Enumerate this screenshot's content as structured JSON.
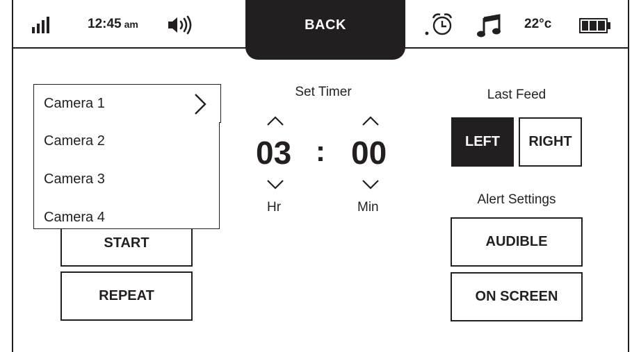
{
  "status_bar": {
    "time": "12:45",
    "ampm": "am",
    "back_label": "BACK",
    "temperature": "22°c",
    "icons": [
      "signal-icon",
      "speaker-icon",
      "alarm-icon",
      "music-icon",
      "battery-icon"
    ]
  },
  "camera_dropdown": {
    "selected": "Camera 1",
    "options": [
      "Camera 2",
      "Camera 3",
      "Camera 4"
    ]
  },
  "controls": {
    "start_label": "START",
    "repeat_label": "REPEAT"
  },
  "timer": {
    "title": "Set Timer",
    "hours": "03",
    "minutes": "00",
    "separator": ":",
    "hours_unit": "Hr",
    "minutes_unit": "Min"
  },
  "last_feed": {
    "title": "Last Feed",
    "left_label": "LEFT",
    "right_label": "RIGHT",
    "selected": "LEFT"
  },
  "alert_settings": {
    "title": "Alert Settings",
    "audible_label": "AUDIBLE",
    "on_screen_label": "ON SCREEN"
  },
  "colors": {
    "ink": "#231f20",
    "background": "#ffffff"
  }
}
